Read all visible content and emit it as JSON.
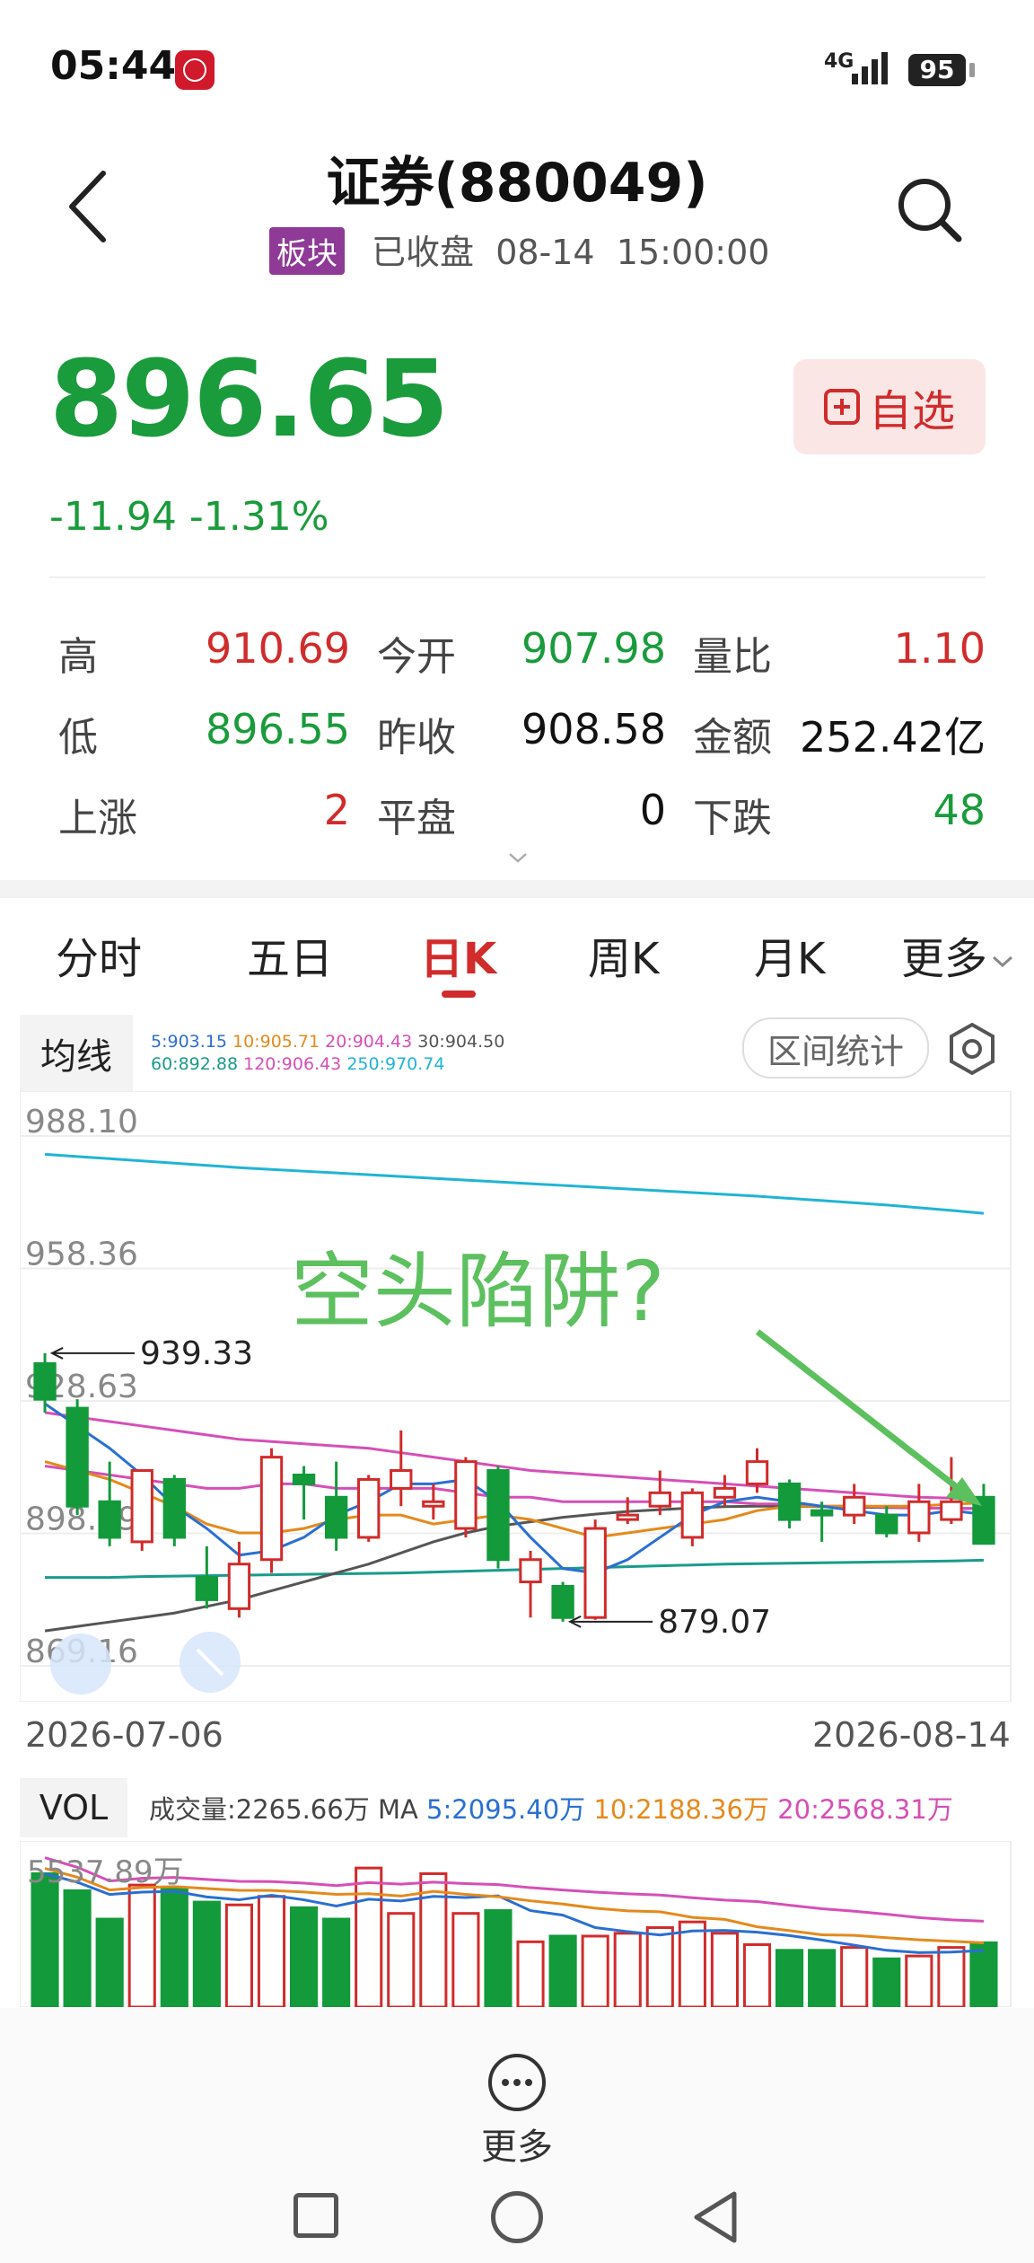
{
  "status_bar": {
    "time": "05:44",
    "network": "4G",
    "battery": "95"
  },
  "header": {
    "title": "证券(880049)",
    "tag": "板块",
    "status": "已收盘",
    "date": "08-14",
    "time": "15:00:00"
  },
  "quote": {
    "price": "896.65",
    "change": "-11.94",
    "change_pct": "-1.31%",
    "watch_label": "自选"
  },
  "stats": {
    "high_label": "高",
    "high": "910.69",
    "open_label": "今开",
    "open": "907.98",
    "ratio_label": "量比",
    "ratio": "1.10",
    "low_label": "低",
    "low": "896.55",
    "prev_label": "昨收",
    "prev": "908.58",
    "amount_label": "金额",
    "amount": "252.42亿",
    "up_label": "上涨",
    "up": "2",
    "flat_label": "平盘",
    "flat": "0",
    "down_label": "下跌",
    "down": "48"
  },
  "tabs": [
    "分时",
    "五日",
    "日K",
    "周K",
    "月K",
    "更多"
  ],
  "ma": {
    "label": "均线",
    "items": [
      {
        "text": "5:903.15",
        "color": "#2a6fd1"
      },
      {
        "text": "10:905.71",
        "color": "#e48a1c"
      },
      {
        "text": "20:904.43",
        "color": "#d64fb6"
      },
      {
        "text": "30:904.50",
        "color": "#555555"
      },
      {
        "text": "60:892.88",
        "color": "#1a9b8c"
      },
      {
        "text": "120:906.43",
        "color": "#d64fb6"
      },
      {
        "text": "250:970.74",
        "color": "#20b4d6"
      }
    ],
    "range_stats_label": "区间统计"
  },
  "chart_data": {
    "type": "candlestick",
    "y_ticks": [
      "988.10",
      "958.36",
      "928.63",
      "898.89",
      "869.16"
    ],
    "ylim": [
      869.16,
      988.1
    ],
    "x_start": "2026-07-06",
    "x_end": "2026-08-14",
    "annotation_text": "空头陷阱?",
    "max_label": "939.33",
    "min_label": "879.07",
    "candles": [
      {
        "o": 937,
        "h": 939.33,
        "c": 929,
        "l": 926
      },
      {
        "o": 927,
        "h": 929,
        "c": 905,
        "l": 903
      },
      {
        "o": 906,
        "h": 915,
        "c": 898,
        "l": 896
      },
      {
        "o": 897,
        "h": 912,
        "c": 913,
        "l": 895
      },
      {
        "o": 911,
        "h": 912,
        "c": 898,
        "l": 896
      },
      {
        "o": 889,
        "h": 896,
        "c": 884,
        "l": 882
      },
      {
        "o": 882,
        "h": 897,
        "c": 892,
        "l": 880
      },
      {
        "o": 893,
        "h": 918,
        "c": 916,
        "l": 890
      },
      {
        "o": 912,
        "h": 914,
        "c": 910,
        "l": 902
      },
      {
        "o": 907,
        "h": 915,
        "c": 898,
        "l": 895
      },
      {
        "o": 898,
        "h": 912,
        "c": 911,
        "l": 897
      },
      {
        "o": 909,
        "h": 922,
        "c": 913,
        "l": 905
      },
      {
        "o": 905,
        "h": 910,
        "c": 906,
        "l": 902
      },
      {
        "o": 900,
        "h": 916,
        "c": 915,
        "l": 898
      },
      {
        "o": 913,
        "h": 914,
        "c": 893,
        "l": 891
      },
      {
        "o": 888,
        "h": 895,
        "c": 893,
        "l": 880
      },
      {
        "o": 887,
        "h": 888,
        "c": 880,
        "l": 879.07
      },
      {
        "o": 880,
        "h": 902,
        "c": 900,
        "l": 879.5
      },
      {
        "o": 902,
        "h": 907,
        "c": 903,
        "l": 901
      },
      {
        "o": 905,
        "h": 913,
        "c": 908,
        "l": 903
      },
      {
        "o": 898,
        "h": 909,
        "c": 908,
        "l": 896
      },
      {
        "o": 907,
        "h": 912,
        "c": 909,
        "l": 905
      },
      {
        "o": 910,
        "h": 918,
        "c": 915,
        "l": 908
      },
      {
        "o": 910,
        "h": 911,
        "c": 902,
        "l": 900
      },
      {
        "o": 904,
        "h": 906,
        "c": 903,
        "l": 897
      },
      {
        "o": 903,
        "h": 910,
        "c": 907,
        "l": 901
      },
      {
        "o": 903,
        "h": 905,
        "c": 899,
        "l": 898
      },
      {
        "o": 899,
        "h": 910,
        "c": 906,
        "l": 897
      },
      {
        "o": 902,
        "h": 916,
        "c": 906,
        "l": 901
      },
      {
        "o": 907,
        "h": 910,
        "c": 896.65,
        "l": 896.55
      }
    ],
    "ma250": [
      984.0,
      983.5,
      983.0,
      982.5,
      982.0,
      981.5,
      981.0,
      980.6,
      980.2,
      979.8,
      979.4,
      979.0,
      978.6,
      978.2,
      977.8,
      977.4,
      977.0,
      976.6,
      976.2,
      975.8,
      975.4,
      975.0,
      974.6,
      974.1,
      973.6,
      973.1,
      972.6,
      972.0,
      971.4,
      970.74
    ],
    "ma120": [
      926.0,
      925.0,
      924.0,
      923.0,
      922.0,
      921.0,
      920.0,
      919.5,
      919.0,
      918.5,
      918.0,
      917.0,
      916.0,
      915.0,
      914.0,
      913.0,
      912.5,
      912.0,
      911.5,
      911.0,
      910.5,
      910.0,
      909.5,
      909.0,
      908.5,
      908.0,
      907.5,
      907.0,
      906.8,
      906.43
    ],
    "ma60": [
      889.0,
      889.0,
      889.0,
      889.2,
      889.3,
      889.4,
      889.5,
      889.6,
      889.7,
      889.8,
      889.9,
      890.0,
      890.2,
      890.4,
      890.6,
      890.8,
      891.0,
      891.2,
      891.4,
      891.6,
      891.8,
      892.0,
      892.1,
      892.2,
      892.3,
      892.4,
      892.5,
      892.6,
      892.7,
      892.88
    ],
    "ma30": [
      877.0,
      878.0,
      879.0,
      880.0,
      881.0,
      882.5,
      884.0,
      886.0,
      888.0,
      890.0,
      892.0,
      894.5,
      897.0,
      899.0,
      900.5,
      901.5,
      902.5,
      903.2,
      903.8,
      904.2,
      904.6,
      904.9,
      905.0,
      905.0,
      904.9,
      904.8,
      904.7,
      904.6,
      904.5,
      904.5
    ],
    "ma5": [
      928.0,
      923.0,
      918.0,
      912.0,
      905.0,
      900.0,
      894.0,
      895.0,
      898.0,
      903.0,
      906.0,
      910.0,
      910.0,
      911.0,
      906.0,
      898.0,
      891.0,
      890.0,
      893.0,
      898.0,
      903.0,
      906.0,
      907.0,
      906.0,
      905.0,
      904.0,
      903.0,
      903.0,
      904.0,
      903.15
    ],
    "ma10": [
      915.0,
      913.0,
      911.0,
      908.0,
      905.0,
      901.0,
      899.0,
      899.0,
      900.0,
      902.0,
      903.0,
      903.0,
      901.0,
      902.0,
      903.0,
      902.0,
      900.0,
      898.0,
      899.0,
      900.0,
      901.0,
      902.0,
      904.0,
      905.0,
      905.0,
      905.0,
      905.0,
      905.0,
      905.5,
      905.71
    ],
    "ma20": [
      914.0,
      913.0,
      912.0,
      911.0,
      910.0,
      909.0,
      909.0,
      910.0,
      910.0,
      909.0,
      909.0,
      909.0,
      909.0,
      908.0,
      907.0,
      907.0,
      906.0,
      906.0,
      906.0,
      906.0,
      906.0,
      906.0,
      905.5,
      905.5,
      905.0,
      905.0,
      904.8,
      904.6,
      904.5,
      904.43
    ]
  },
  "volume": {
    "label": "VOL",
    "legend_prefix": "成交量:",
    "legend_value": "2265.66万",
    "legend_ma": "MA",
    "ma5": "5:2095.40万",
    "ma10": "10:2188.36万",
    "ma20": "20:2568.31万",
    "ma5_color": "#2a6fd1",
    "ma10_color": "#e48a1c",
    "ma20_color": "#d64fb6",
    "max_label": "5537.89万",
    "values": [
      4700,
      4100,
      3100,
      4300,
      4200,
      3700,
      3600,
      3900,
      3500,
      3100,
      4900,
      3300,
      4700,
      3300,
      3400,
      2300,
      2500,
      2500,
      2600,
      2800,
      3000,
      2600,
      2200,
      2000,
      2000,
      2100,
      1700,
      1800,
      2100,
      2265.66
    ]
  },
  "bottom": {
    "more_label": "更多"
  }
}
